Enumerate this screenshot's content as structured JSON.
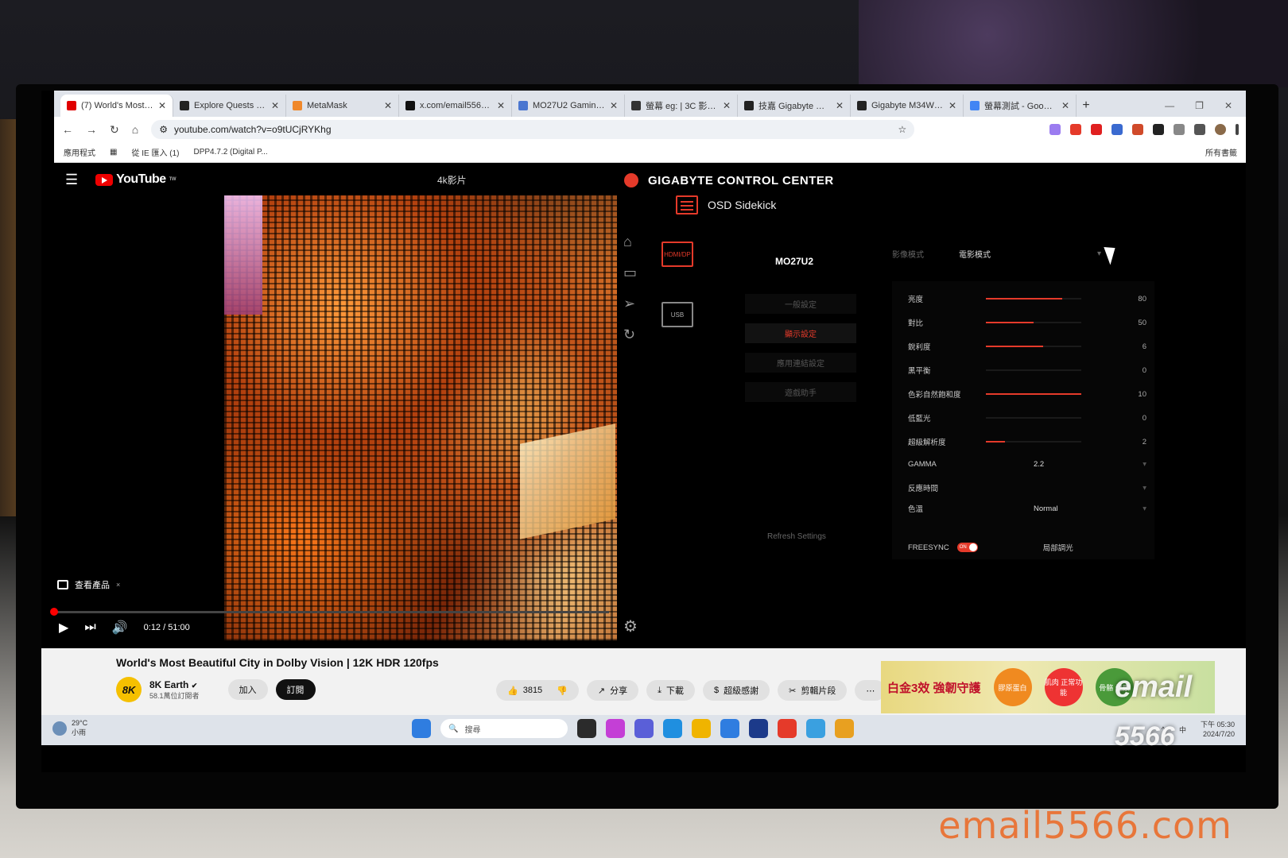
{
  "browser": {
    "tabs": [
      {
        "title": "(7) World's Most Be",
        "color": "#e00000",
        "active": true
      },
      {
        "title": "Explore Quests | Gal",
        "color": "#222222"
      },
      {
        "title": "MetaMask",
        "color": "#f0882a"
      },
      {
        "title": "x.com/email5566gp",
        "color": "#111111"
      },
      {
        "title": "MO27U2 Gaming M",
        "color": "#4a76d0"
      },
      {
        "title": "螢幕 eg: | 3C 影音分",
        "color": "#333333"
      },
      {
        "title": "技嘉 Gigabyte GS32",
        "color": "#222222"
      },
      {
        "title": "Gigabyte M34WQ 2",
        "color": "#222222"
      },
      {
        "title": "螢幕測試 - Google 搜",
        "color": "#4285f4"
      }
    ],
    "url": "youtube.com/watch?v=o9tUCjRYKhg",
    "bookmarks": [
      "應用程式",
      "從 IE 匯入 (1)",
      "DPP4.7.2 (Digital P..."
    ],
    "bookmarks_all": "所有書籤"
  },
  "youtube": {
    "logo": "YouTube",
    "logo_sup": "TW",
    "video_title_overlay": "4k影片",
    "product_chip": "查看產品",
    "time": "0:12 / 51:00",
    "progress": 0.004,
    "title": "World's Most Beautiful City in Dolby Vision | 12K HDR 120fps",
    "channel": {
      "avatar": "8K",
      "name": "8K Earth",
      "subs": "58.1萬位訂閱者"
    },
    "join": "加入",
    "subscribe": "訂閱",
    "likes": "3815",
    "share": "分享",
    "download": "下載",
    "thanks": "超級感謝",
    "clip": "剪輯片段",
    "more": "⋯"
  },
  "gcc": {
    "app_title": "GIGABYTE CONTROL CENTER",
    "module": "OSD Sidekick",
    "ports": {
      "hdmi": "HDMI/DP",
      "usb": "USB"
    },
    "model": "MO27U2",
    "menu": [
      {
        "label": "一般設定",
        "selected": false
      },
      {
        "label": "顯示設定",
        "selected": true
      },
      {
        "label": "應用連結設定",
        "selected": false
      },
      {
        "label": "遊戲助手",
        "selected": false
      }
    ],
    "refresh": "Refresh Settings",
    "picture_mode_label": "影像模式",
    "picture_mode_value": "電影模式",
    "sliders": [
      {
        "label": "亮度",
        "value": 80
      },
      {
        "label": "對比",
        "value": 50
      },
      {
        "label": "銳利度",
        "value": 6
      },
      {
        "label": "黑平衡",
        "value": 0
      },
      {
        "label": "色彩自然飽和度",
        "value": 10
      },
      {
        "label": "低藍光",
        "value": 0
      },
      {
        "label": "超級解析度",
        "value": 2
      }
    ],
    "gamma": {
      "label": "GAMMA",
      "value": "2.2"
    },
    "response": {
      "label": "反應時間",
      "value": ""
    },
    "color_temp": {
      "label": "色溫",
      "value": "Normal"
    },
    "freesync": {
      "label": "FREESYNC",
      "state": "ON"
    },
    "local_dimming": "局部調光"
  },
  "ad": {
    "slogan": "白金3效 強韌守護",
    "badge1": "膠原蛋白",
    "badge2": "肌肉 正常功能",
    "badge3": "骨骼 健康"
  },
  "watermark": {
    "line1": "email",
    "line2": "5566"
  },
  "taskbar": {
    "weather_temp": "29°C",
    "weather_desc": "小雨",
    "search": "搜尋",
    "ime": "中",
    "time": "下午 05:30",
    "date": "2024/7/20",
    "app_colors": [
      "#2b2b2b",
      "#c43fd6",
      "#5a5fd8",
      "#1f8fe0",
      "#f0b400",
      "#2f7de0",
      "#1c3a8a",
      "#e53a2a",
      "#3aa0e0",
      "#e8a020"
    ]
  },
  "site_watermark": "email5566.com"
}
